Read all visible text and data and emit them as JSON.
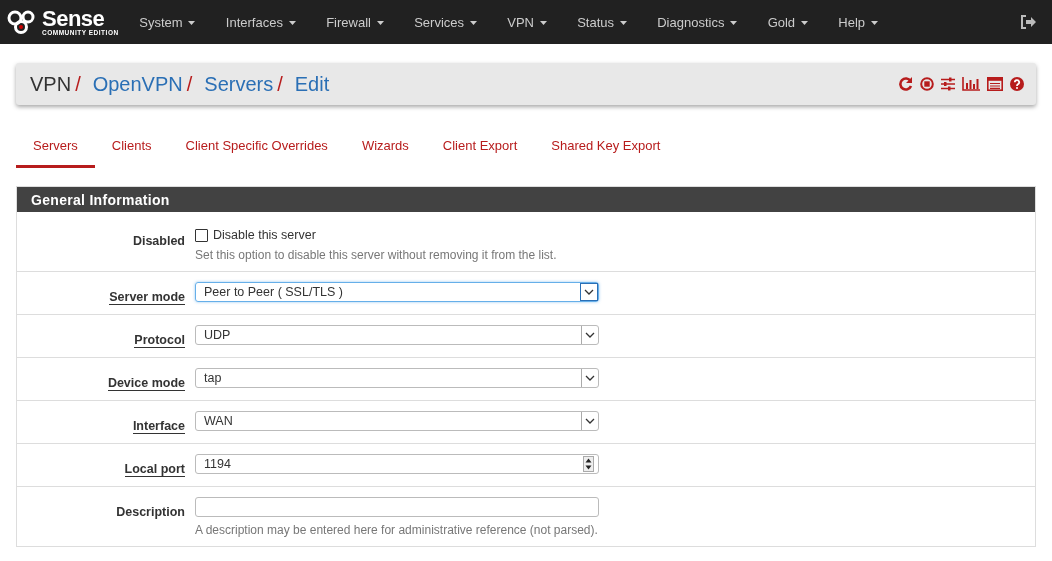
{
  "navbar": {
    "brand": "Sense",
    "brand_sub": "COMMUNITY EDITION",
    "menus": [
      "System",
      "Interfaces",
      "Firewall",
      "Services",
      "VPN",
      "Status",
      "Diagnostics",
      "Gold",
      "Help"
    ]
  },
  "breadcrumb": [
    {
      "label": "VPN",
      "link": false,
      "separator": "/"
    },
    {
      "label": "OpenVPN",
      "link": true,
      "separator": "/"
    },
    {
      "label": "Servers",
      "link": true,
      "separator": "/"
    },
    {
      "label": "Edit",
      "link": true
    }
  ],
  "tabs": [
    {
      "label": "Servers",
      "selected": true
    },
    {
      "label": "Clients",
      "selected": false
    },
    {
      "label": "Client Specific Overrides",
      "selected": false
    },
    {
      "label": "Wizards",
      "selected": false
    },
    {
      "label": "Client Export",
      "selected": false
    },
    {
      "label": "Shared Key Export",
      "selected": false
    }
  ],
  "panel": {
    "title": "General Information",
    "rows": [
      {
        "label": "Disabled",
        "help_link": false,
        "kind": "checkbox",
        "checked": false,
        "option": "Disable this server",
        "hint": "Set this option to disable this server without removing it from the list."
      },
      {
        "label": "Server mode",
        "help_link": true,
        "kind": "select",
        "value": "Peer to Peer ( SSL/TLS )",
        "focused": true
      },
      {
        "label": "Protocol",
        "help_link": true,
        "kind": "select",
        "value": "UDP",
        "focused": false
      },
      {
        "label": "Device mode",
        "help_link": true,
        "kind": "select",
        "value": "tap",
        "focused": false
      },
      {
        "label": "Interface",
        "help_link": true,
        "kind": "select",
        "value": "WAN",
        "focused": false
      },
      {
        "label": "Local port",
        "help_link": true,
        "kind": "number",
        "value": "1194",
        "focused": false
      },
      {
        "label": "Description",
        "help_link": false,
        "kind": "text",
        "value": "",
        "focused": false,
        "hint": "A description may be entered here for administrative reference (not parsed)."
      }
    ]
  }
}
